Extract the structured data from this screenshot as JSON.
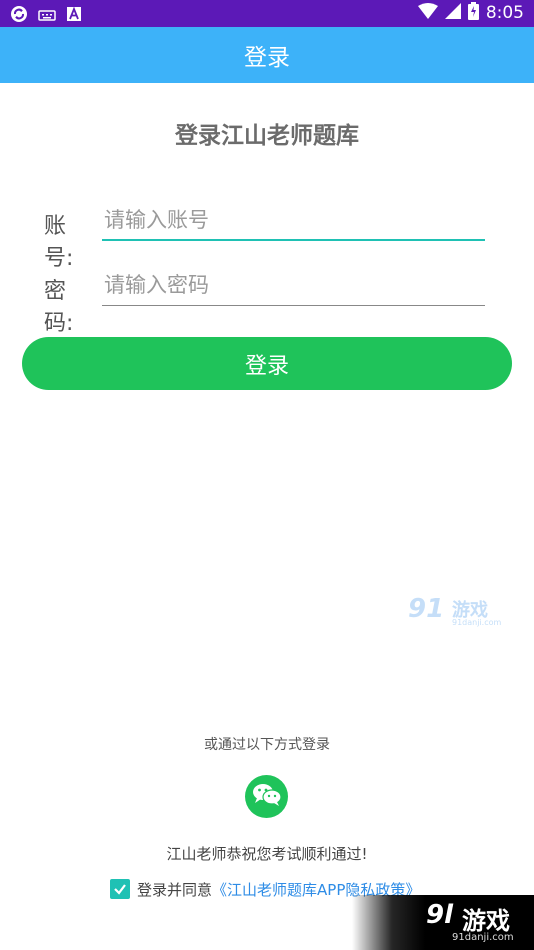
{
  "status_bar": {
    "time": "8:05",
    "bg_color": "#5c19b7",
    "left_icons": [
      "sync-icon",
      "keyboard-icon",
      "a-icon"
    ],
    "right_icons": [
      "wifi-icon",
      "signal-icon",
      "battery-icon"
    ]
  },
  "app_bar": {
    "title": "登录",
    "bg_color": "#3db2f9"
  },
  "form": {
    "heading": "登录江山老师题库",
    "account": {
      "label": "账号:",
      "placeholder": "请输入账号",
      "value": ""
    },
    "password": {
      "label": "密码:",
      "placeholder": "请输入密码",
      "value": ""
    },
    "login_button": "登录",
    "accent_color": "#1fc35a",
    "focus_color": "#1fc1b4"
  },
  "watermark_mid": {
    "number": "91",
    "text": "游戏",
    "url": "91danji.com"
  },
  "other_login": {
    "label": "或通过以下方式登录",
    "icon": "wechat-icon"
  },
  "congrats": "江山老师恭祝您考试顺利通过!",
  "agreement": {
    "checked": true,
    "text": "登录并同意",
    "policy_link": "《江山老师题库APP隐私政策》"
  },
  "watermark_corner": {
    "number": "9l",
    "text": "游戏",
    "url": "91danji.com"
  }
}
